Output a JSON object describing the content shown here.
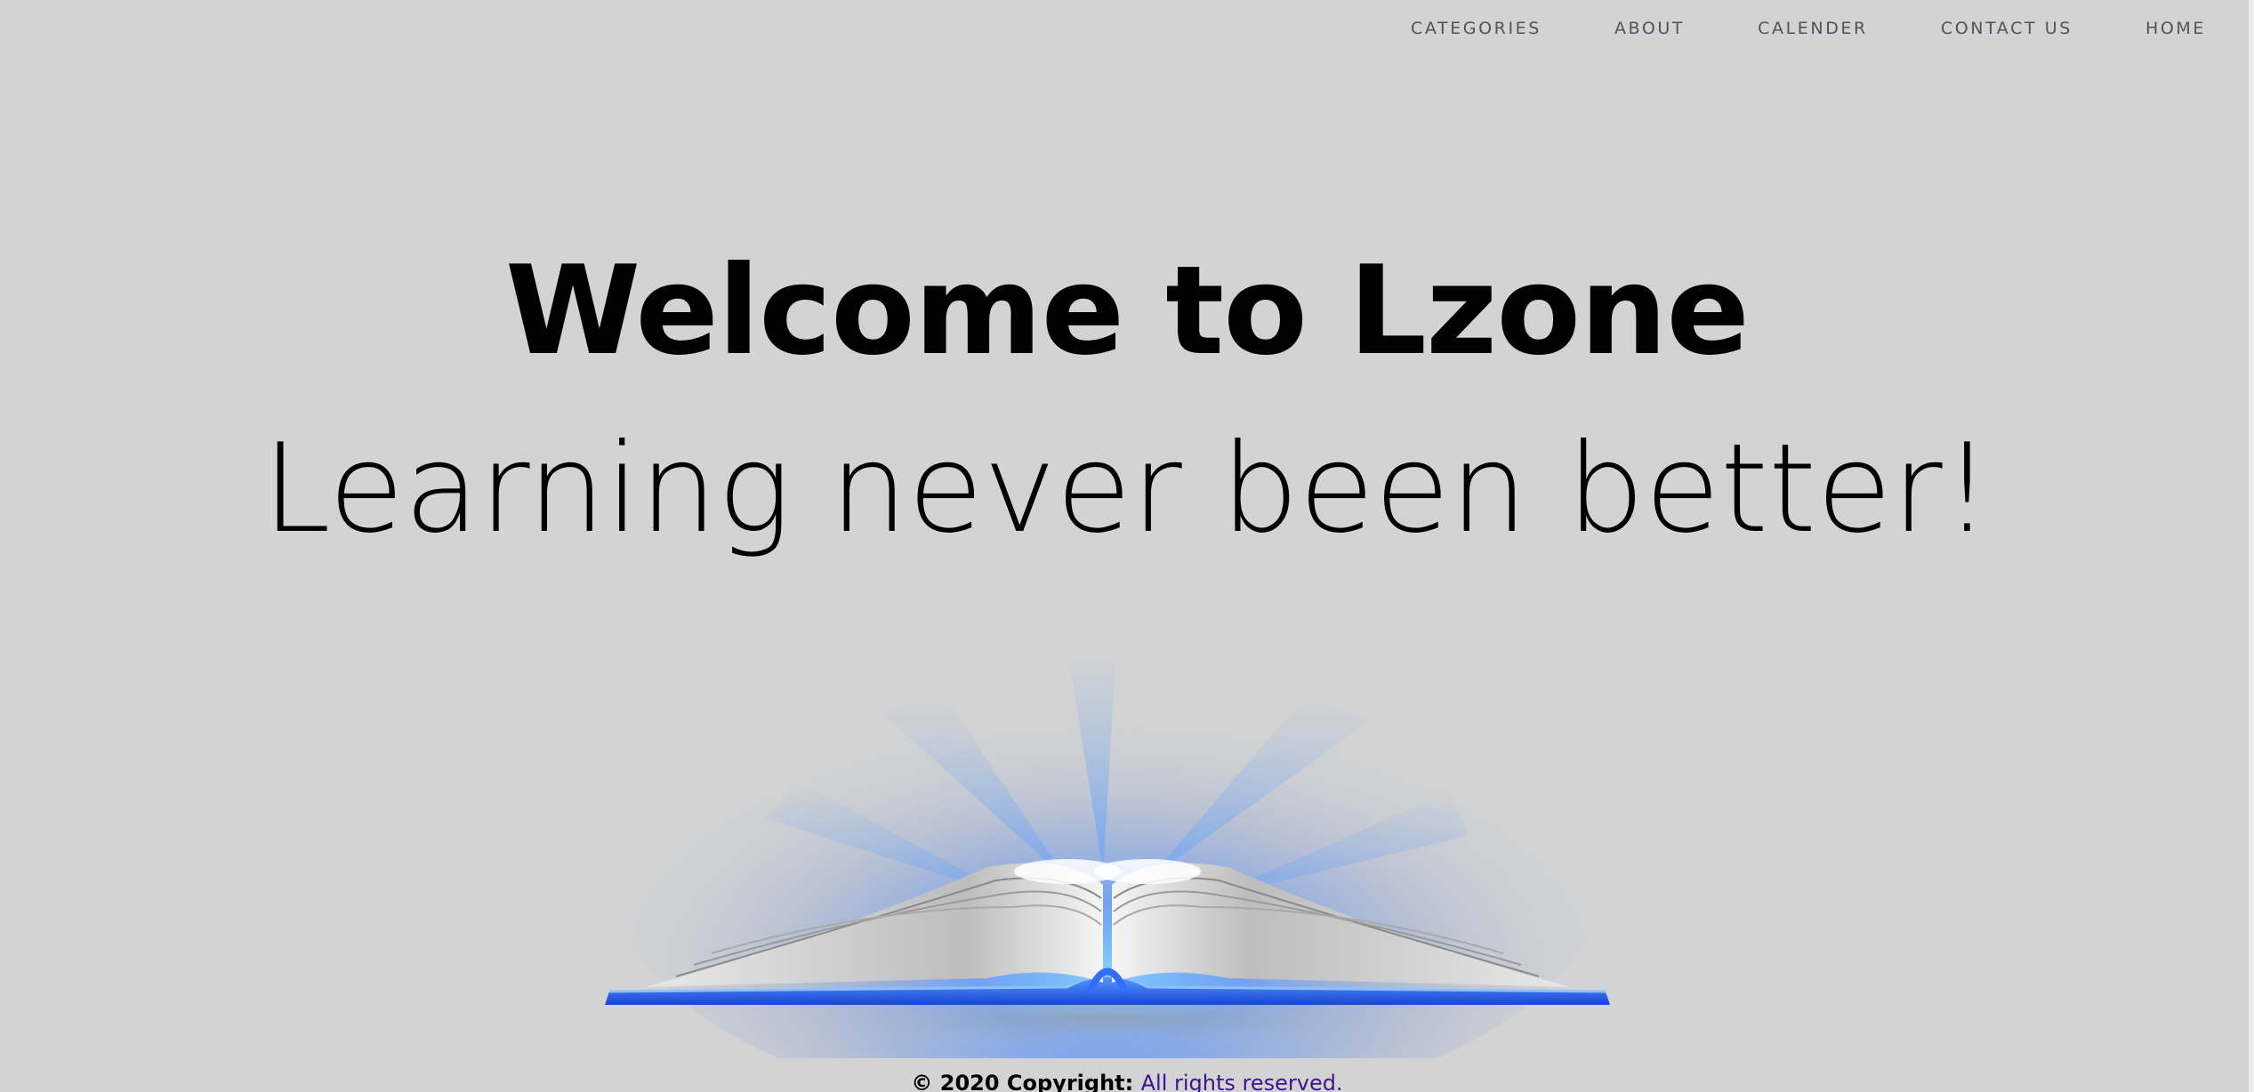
{
  "nav": {
    "items": [
      {
        "label": "CATEGORIES"
      },
      {
        "label": "ABOUT"
      },
      {
        "label": "CALENDER"
      },
      {
        "label": "CONTACT US"
      },
      {
        "label": "HOME"
      }
    ]
  },
  "hero": {
    "title": "Welcome to Lzone",
    "subtitle": "Learning never been better!"
  },
  "footer": {
    "copyright": "© 2020 Copyright:",
    "rights": "All rights reserved."
  },
  "colors": {
    "background": "#d3d3d3",
    "nav_text": "#4f5359",
    "book_blue": "#2f6fff",
    "rights_link": "#3b1590"
  },
  "icons": {
    "book": "open-book-illustration"
  }
}
